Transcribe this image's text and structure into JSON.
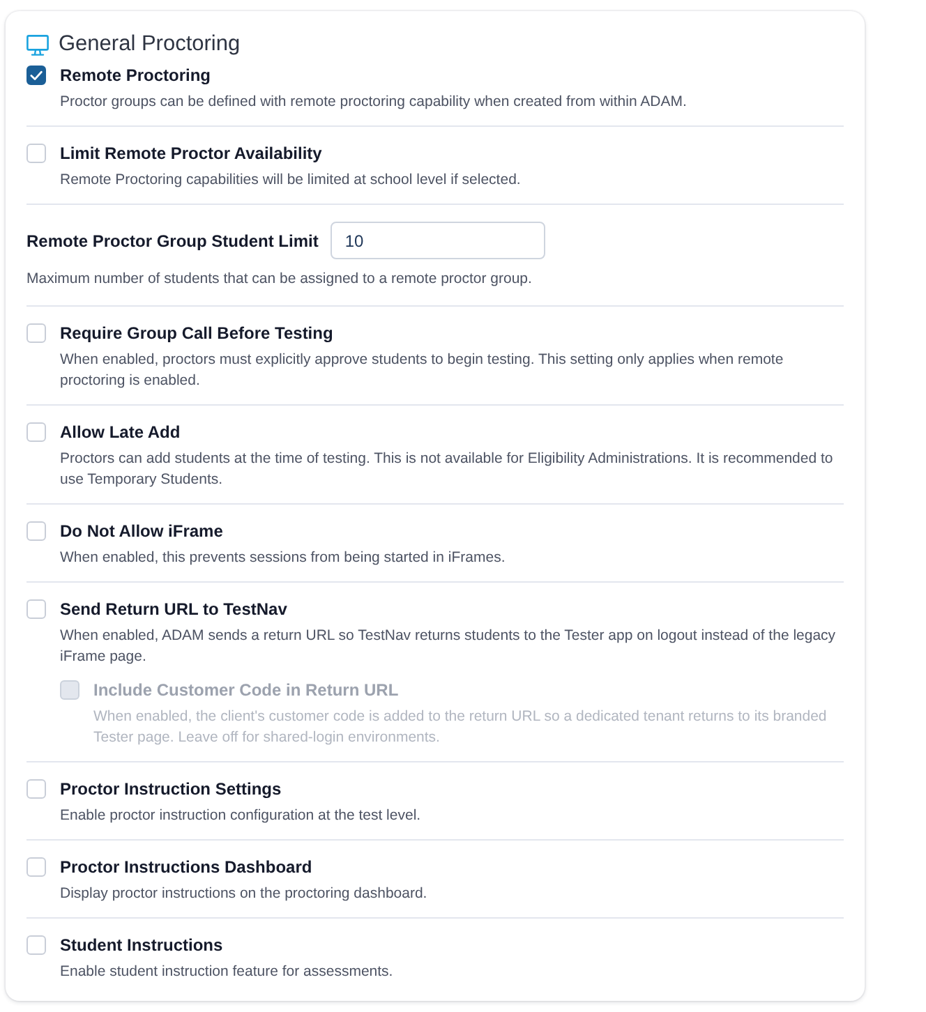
{
  "section": {
    "title": "General Proctoring",
    "settings": [
      {
        "kind": "checkbox",
        "label": "Remote Proctoring",
        "description": "Proctor groups can be defined with remote proctoring capability when created from within ADAM.",
        "checked": true,
        "disabled": false
      },
      {
        "kind": "checkbox",
        "label": "Limit Remote Proctor Availability",
        "description": "Remote Proctoring capabilities will be limited at school level if selected.",
        "checked": false,
        "disabled": false
      },
      {
        "kind": "number",
        "label": "Remote Proctor Group Student Limit",
        "value": "10",
        "description": "Maximum number of students that can be assigned to a remote proctor group.",
        "disabled": false
      },
      {
        "kind": "checkbox",
        "label": "Require Group Call Before Testing",
        "description": "When enabled, proctors must explicitly approve students to begin testing. This setting only applies when remote proctoring is enabled.",
        "checked": false,
        "disabled": false
      },
      {
        "kind": "checkbox",
        "label": "Allow Late Add",
        "description": "Proctors can add students at the time of testing. This is not available for Eligibility Administrations. It is recommended to use Temporary Students.",
        "checked": false,
        "disabled": false
      },
      {
        "kind": "checkbox",
        "label": "Do Not Allow iFrame",
        "description": "When enabled, this prevents sessions from being started in iFrames.",
        "checked": false,
        "disabled": false
      },
      {
        "kind": "checkbox",
        "label": "Send Return URL to TestNav",
        "description": "When enabled, ADAM sends a return URL so TestNav returns students to the Tester app on logout instead of the legacy iFrame page.",
        "checked": false,
        "disabled": false,
        "children": [
          {
            "kind": "checkbox",
            "label": "Include Customer Code in Return URL",
            "description": "When enabled, the client's customer code is added to the return URL so a dedicated tenant returns to its branded Tester page. Leave off for shared-login environments.",
            "checked": false,
            "disabled": true
          }
        ]
      },
      {
        "kind": "checkbox",
        "label": "Proctor Instruction Settings",
        "description": "Enable proctor instruction configuration at the test level.",
        "checked": false,
        "disabled": false
      },
      {
        "kind": "checkbox",
        "label": "Proctor Instructions Dashboard",
        "description": "Display proctor instructions on the proctoring dashboard.",
        "checked": false,
        "disabled": false
      },
      {
        "kind": "checkbox",
        "label": "Student Instructions",
        "description": "Enable student instruction feature for assessments.",
        "checked": false,
        "disabled": false
      }
    ]
  }
}
